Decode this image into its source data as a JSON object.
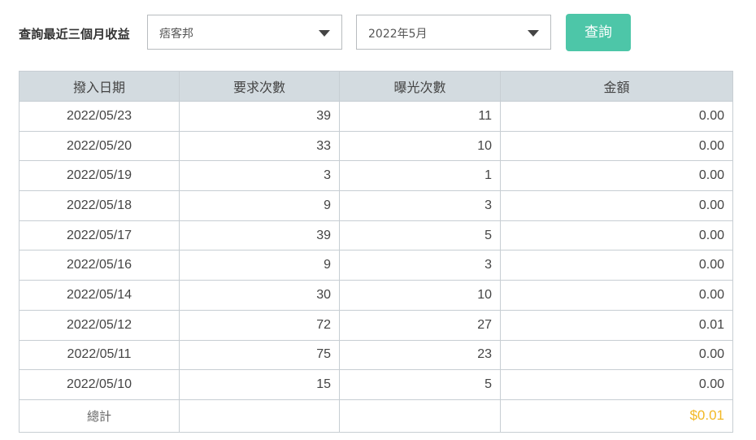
{
  "filter": {
    "label": "查詢最近三個月收益",
    "site_value": "痞客邦",
    "month_value": "2022年5月",
    "query_button": "查詢"
  },
  "table": {
    "headers": [
      "撥入日期",
      "要求次數",
      "曝光次數",
      "金額"
    ],
    "rows": [
      {
        "date": "2022/05/23",
        "requests": "39",
        "impressions": "11",
        "amount": "0.00"
      },
      {
        "date": "2022/05/20",
        "requests": "33",
        "impressions": "10",
        "amount": "0.00"
      },
      {
        "date": "2022/05/19",
        "requests": "3",
        "impressions": "1",
        "amount": "0.00"
      },
      {
        "date": "2022/05/18",
        "requests": "9",
        "impressions": "3",
        "amount": "0.00"
      },
      {
        "date": "2022/05/17",
        "requests": "39",
        "impressions": "5",
        "amount": "0.00"
      },
      {
        "date": "2022/05/16",
        "requests": "9",
        "impressions": "3",
        "amount": "0.00"
      },
      {
        "date": "2022/05/14",
        "requests": "30",
        "impressions": "10",
        "amount": "0.00"
      },
      {
        "date": "2022/05/12",
        "requests": "72",
        "impressions": "27",
        "amount": "0.01"
      },
      {
        "date": "2022/05/11",
        "requests": "75",
        "impressions": "23",
        "amount": "0.00"
      },
      {
        "date": "2022/05/10",
        "requests": "15",
        "impressions": "5",
        "amount": "0.00"
      }
    ],
    "total_label": "總計",
    "total_amount": "$0.01"
  },
  "colors": {
    "accent": "#4dc6a8",
    "header_bg": "#d3dbe0",
    "total_amount": "#f2b824"
  }
}
